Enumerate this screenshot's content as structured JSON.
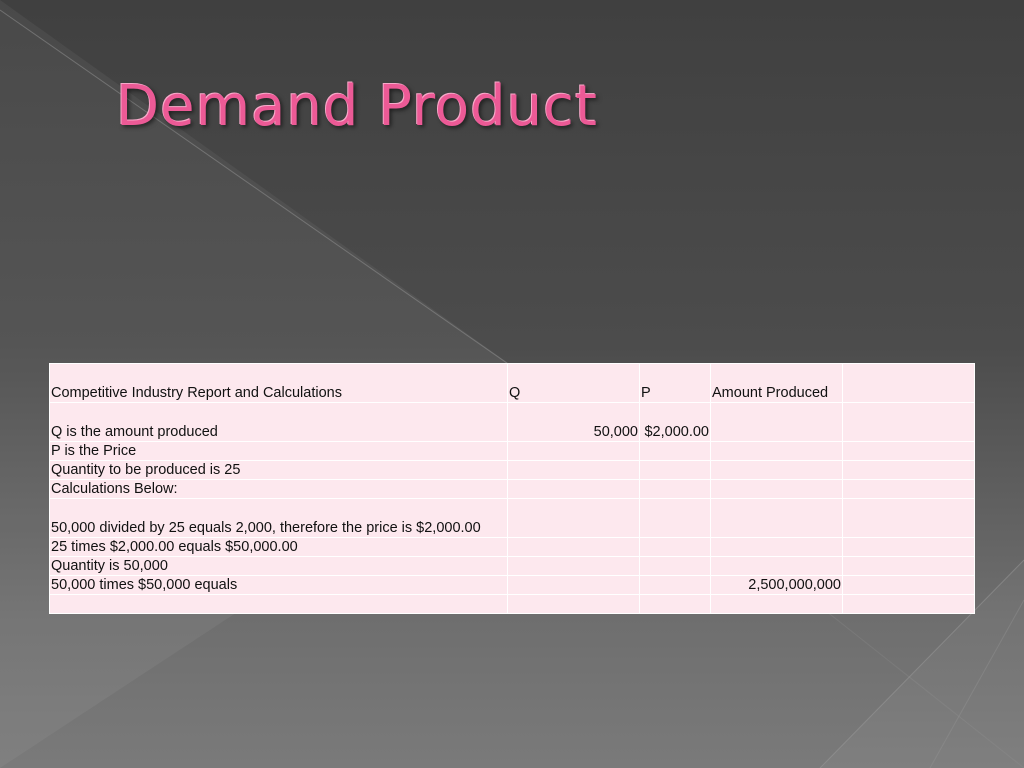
{
  "slide": {
    "title": "Demand Product"
  },
  "table": {
    "rows": [
      [
        "Competitive Industry Report and Calculations",
        "Q",
        "P",
        "Amount Produced",
        ""
      ],
      [
        "Q is the amount produced",
        "50,000",
        "$2,000.00",
        "",
        ""
      ],
      [
        "P is the Price",
        "",
        "",
        "",
        ""
      ],
      [
        "Quantity to be produced is 25",
        "",
        "",
        "",
        ""
      ],
      [
        "Calculations Below:",
        "",
        "",
        "",
        ""
      ],
      [
        "50,000 divided by 25 equals 2,000, therefore the price is $2,000.00",
        "",
        "",
        "",
        ""
      ],
      [
        "25 times $2,000.00 equals $50,000.00",
        "",
        "",
        "",
        ""
      ],
      [
        "Quantity is 50,000",
        "",
        "",
        "",
        ""
      ],
      [
        "50,000 times $50,000 equals",
        "",
        "",
        "2,500,000,000",
        ""
      ],
      [
        "",
        "",
        "",
        "",
        ""
      ]
    ]
  },
  "colors": {
    "title": "#ec5a96",
    "table_fill": "#fde8ee",
    "background": "#4a4a4a"
  }
}
